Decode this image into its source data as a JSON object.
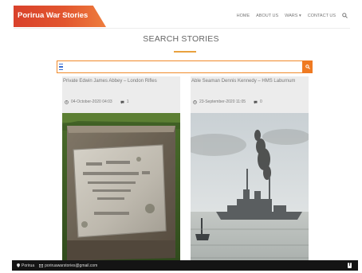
{
  "header": {
    "logo_text": "Porirua War Stories",
    "nav": {
      "home": "HOME",
      "about": "ABOUT US",
      "wars": "WARS ▾",
      "contact": "CONTACT US"
    }
  },
  "page": {
    "title": "SEARCH STORIES"
  },
  "search": {
    "value": "",
    "placeholder": ""
  },
  "cards": [
    {
      "title": "Private Edwin James Abbey – London Rifles",
      "date": "04-October-2020 04:03",
      "comments": "1"
    },
    {
      "title": "Able Seaman Dennis Kennedy – HMS Laburnum",
      "date": "23-September-2020 11:05",
      "comments": "0"
    }
  ],
  "footer": {
    "location": "Porirua",
    "email": "poriruawarstories@gmail.com"
  },
  "colors": {
    "accent": "#ef7a22",
    "brand_red": "#d9412b",
    "footer_bg": "#141414"
  }
}
